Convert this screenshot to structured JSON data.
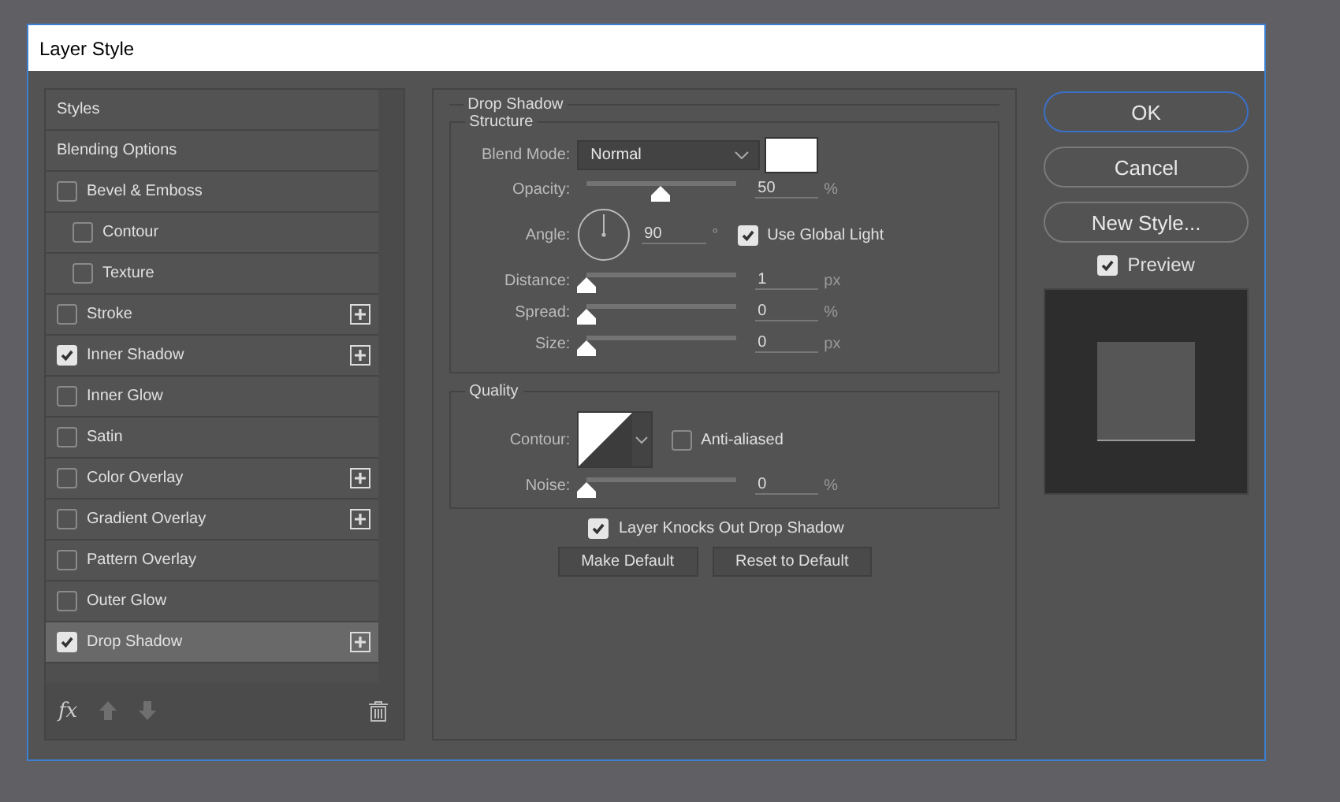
{
  "window": {
    "title": "Layer Style"
  },
  "styles": [
    {
      "label": "Styles",
      "kind": "header",
      "selected": false
    },
    {
      "label": "Blending Options",
      "kind": "header",
      "selected": false
    },
    {
      "label": "Bevel & Emboss",
      "kind": "effect",
      "checked": false,
      "add": false,
      "selected": false,
      "children": [
        {
          "label": "Contour",
          "kind": "effect",
          "checked": false,
          "add": false,
          "selected": false
        },
        {
          "label": "Texture",
          "kind": "effect",
          "checked": false,
          "add": false,
          "selected": false
        }
      ]
    },
    {
      "label": "Stroke",
      "kind": "effect",
      "checked": false,
      "add": true,
      "selected": false
    },
    {
      "label": "Inner Shadow",
      "kind": "effect",
      "checked": true,
      "add": true,
      "selected": false
    },
    {
      "label": "Inner Glow",
      "kind": "effect",
      "checked": false,
      "add": false,
      "selected": false
    },
    {
      "label": "Satin",
      "kind": "effect",
      "checked": false,
      "add": false,
      "selected": false
    },
    {
      "label": "Color Overlay",
      "kind": "effect",
      "checked": false,
      "add": true,
      "selected": false
    },
    {
      "label": "Gradient Overlay",
      "kind": "effect",
      "checked": false,
      "add": true,
      "selected": false
    },
    {
      "label": "Pattern Overlay",
      "kind": "effect",
      "checked": false,
      "add": false,
      "selected": false
    },
    {
      "label": "Outer Glow",
      "kind": "effect",
      "checked": false,
      "add": false,
      "selected": false
    },
    {
      "label": "Drop Shadow",
      "kind": "effect",
      "checked": true,
      "add": true,
      "selected": true
    }
  ],
  "footer": {
    "fx": "fx"
  },
  "panel": {
    "title": "Drop Shadow",
    "structure": {
      "title": "Structure",
      "blend_mode_label": "Blend Mode:",
      "blend_mode": "Normal",
      "color": "#ffffff",
      "rows": [
        {
          "kind": "slider",
          "label": "Opacity:",
          "level": 0.5,
          "value": "50",
          "unit": "%"
        },
        {
          "kind": "angle",
          "label": "Angle:",
          "value": "90",
          "unit": "°",
          "global_light": {
            "label": "Use Global Light",
            "checked": true
          }
        },
        {
          "kind": "slider",
          "label": "Distance:",
          "level": 0,
          "value": "1",
          "unit": "px"
        },
        {
          "kind": "slider",
          "label": "Spread:",
          "level": 0,
          "value": "0",
          "unit": "%"
        },
        {
          "kind": "slider",
          "label": "Size:",
          "level": 0,
          "value": "0",
          "unit": "px"
        }
      ]
    },
    "quality": {
      "title": "Quality",
      "contour_label": "Contour:",
      "anti_aliased": {
        "label": "Anti-aliased",
        "checked": false
      },
      "noise": {
        "label": "Noise:",
        "level": 0,
        "value": "0",
        "unit": "%"
      }
    },
    "knockout": {
      "label": "Layer Knocks Out Drop Shadow",
      "checked": true
    },
    "buttons": [
      "Make Default",
      "Reset to Default"
    ]
  },
  "buttons": [
    {
      "label": "OK",
      "selected": true
    },
    {
      "label": "Cancel",
      "selected": false
    },
    {
      "label": "New Style...",
      "selected": false
    }
  ],
  "preview": {
    "label": "Preview",
    "checked": true
  }
}
